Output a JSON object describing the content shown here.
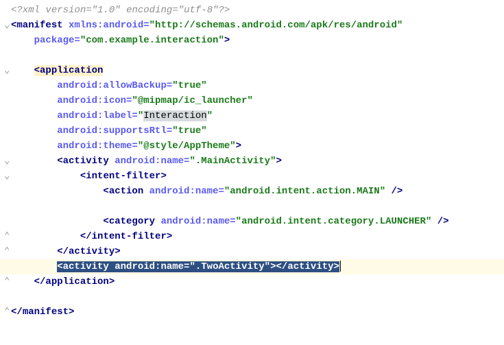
{
  "code": {
    "xml_decl_open": "<?",
    "xml_decl_tag": "xml",
    "xml_decl_attr1": " version=",
    "xml_decl_val1": "\"1.0\"",
    "xml_decl_attr2": " encoding=",
    "xml_decl_val2": "\"utf-8\"",
    "xml_decl_close": "?>",
    "manifest_open": "<",
    "manifest_tag": "manifest",
    "manifest_attr1": " xmlns:android=",
    "manifest_val1": "\"http://schemas.android.com/apk/res/android\"",
    "manifest_attr2": "package=",
    "manifest_val2": "\"com.example.interaction\"",
    "manifest_end": ">",
    "app_open": "<",
    "app_tag": "application",
    "app_attr1": "android:allowBackup=",
    "app_val1": "\"true\"",
    "app_attr2": "android:icon=",
    "app_val2": "\"@mipmap/ic_launcher\"",
    "app_attr3": "android:label=",
    "app_val3_quote": "\"",
    "app_val3_text": "Interaction",
    "app_val3_quote2": "\"",
    "app_attr4": "android:supportsRtl=",
    "app_val4": "\"true\"",
    "app_attr5": "android:theme=",
    "app_val5": "\"@style/AppTheme\"",
    "app_end": ">",
    "act1_open": "<",
    "act1_tag": "activity",
    "act1_attr": " android:name=",
    "act1_val": "\".MainActivity\"",
    "act1_end": ">",
    "if_open": "<",
    "if_tag": "intent-filter",
    "if_end": ">",
    "action_open": "<",
    "action_tag": "action",
    "action_attr": " android:name=",
    "action_val": "\"android.intent.action.MAIN\"",
    "action_end": " />",
    "cat_open": "<",
    "cat_tag": "category",
    "cat_attr": " android:name=",
    "cat_val": "\"android.intent.category.LAUNCHER\"",
    "cat_end": " />",
    "if_close_open": "</",
    "if_close_tag": "intent-filter",
    "if_close_end": ">",
    "act1_close_open": "</",
    "act1_close_tag": "activity",
    "act1_close_end": ">",
    "act2_open": "<",
    "act2_tag": "activity",
    "act2_attr": " android:name=",
    "act2_val": "\".TwoActivity\"",
    "act2_end": ">",
    "act2_close_open": "</",
    "act2_close_tag": "activity",
    "act2_close_end": ">",
    "app_close_open": "</",
    "app_close_tag": "application",
    "app_close_end": ">",
    "manifest_close_open": "</",
    "manifest_close_tag": "manifest",
    "manifest_close_end": ">",
    "fold_open": "⌄",
    "fold_close": "⌃"
  }
}
